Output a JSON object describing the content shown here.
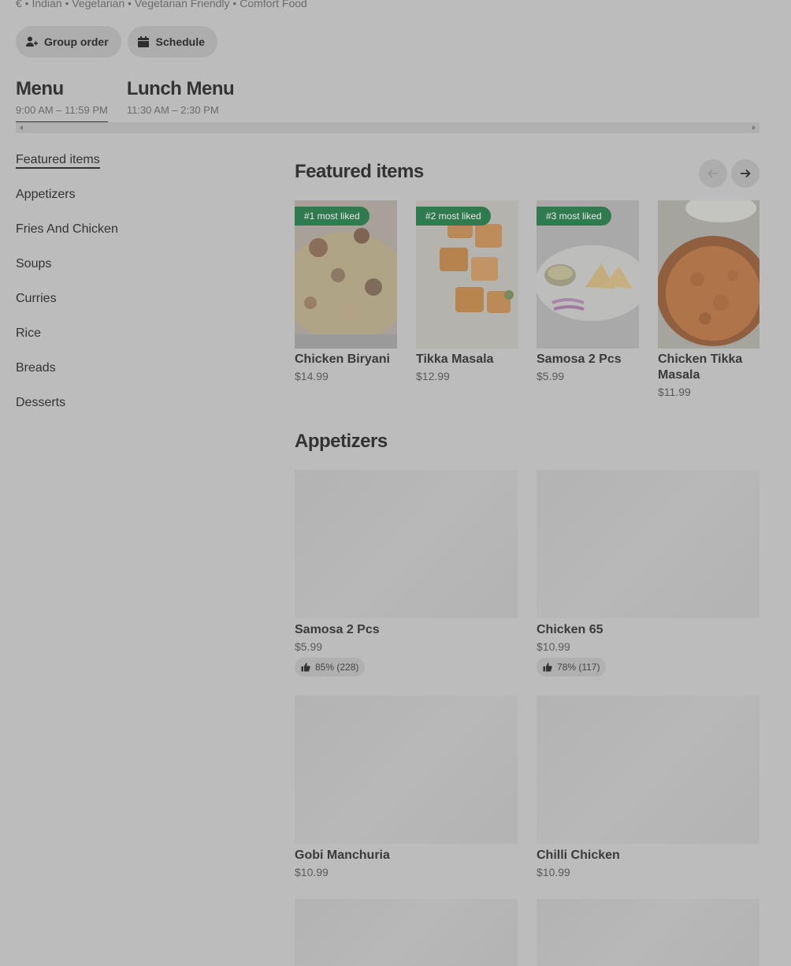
{
  "restaurant": {
    "tags_line": "€ • Indian • Vegetarian • Vegetarian Friendly • Comfort Food"
  },
  "actions": {
    "group_order": "Group order",
    "schedule": "Schedule"
  },
  "menus": [
    {
      "title": "Menu",
      "hours": "9:00 AM – 11:59 PM",
      "active": true
    },
    {
      "title": "Lunch Menu",
      "hours": "11:30 AM – 2:30 PM",
      "active": false
    }
  ],
  "sidebar": {
    "items": [
      {
        "label": "Featured items"
      },
      {
        "label": "Appetizers"
      },
      {
        "label": "Fries And Chicken"
      },
      {
        "label": "Soups"
      },
      {
        "label": "Curries"
      },
      {
        "label": "Rice"
      },
      {
        "label": "Breads"
      },
      {
        "label": "Desserts"
      }
    ]
  },
  "featured": {
    "title": "Featured items",
    "items": [
      {
        "badge": "#1 most liked",
        "name": "Chicken Biryani",
        "price": "$14.99",
        "image": "chicken-biryani-photo"
      },
      {
        "badge": "#2 most liked",
        "name": "Tikka Masala",
        "price": "$12.99",
        "image": "tikka-masala-photo"
      },
      {
        "badge": "#3 most liked",
        "name": "Samosa 2 Pcs",
        "price": "$5.99",
        "image": "samosa-photo"
      },
      {
        "badge": "",
        "name": "Chicken Tikka Masala",
        "price": "$11.99",
        "image": "chicken-tikka-masala-photo"
      }
    ]
  },
  "appetizers": {
    "title": "Appetizers",
    "items": [
      {
        "name": "Samosa 2 Pcs",
        "price": "$5.99",
        "rating": "85% (228)"
      },
      {
        "name": "Chicken 65",
        "price": "$10.99",
        "rating": "78% (117)"
      },
      {
        "name": "Gobi Manchuria",
        "price": "$10.99"
      },
      {
        "name": "Chilli Chicken",
        "price": "$10.99"
      }
    ]
  },
  "icons": {
    "group": "person-add-icon",
    "schedule": "calendar-icon",
    "prev": "arrow-left-icon",
    "next": "arrow-right-icon",
    "thumb": "thumbs-up-icon"
  },
  "colors": {
    "badge": "#2f7a4f",
    "overlay_bg": "#bcbcbc"
  }
}
